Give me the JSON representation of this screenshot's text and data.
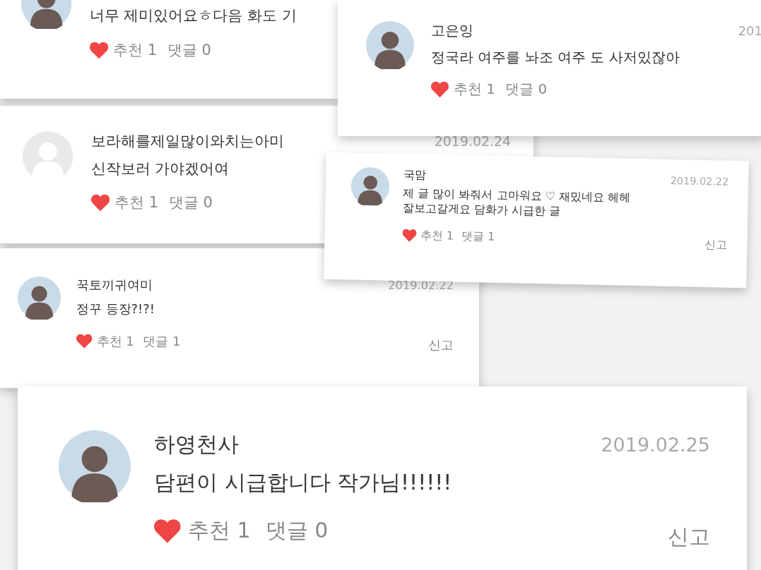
{
  "comments": [
    {
      "avatar": {
        "kind": "photo"
      },
      "lines": [
        "너무 제미있어요ㅎ다음 화도 기"
      ],
      "liked": true,
      "likes": "추천 1",
      "replies": "댓글 0"
    },
    {
      "avatar": {
        "kind": "default"
      },
      "name": "보라해를제일많이와치는아미",
      "date": "2019.02.24",
      "lines": [
        "신작보러 가야겠어여"
      ],
      "liked": true,
      "likes": "추천 1",
      "replies": "댓글 0"
    },
    {
      "avatar": {
        "kind": "photo"
      },
      "name": "고은잉",
      "date": "201",
      "lines": [
        "정국라 여주를 놔조 여주 도 사저있잖아"
      ],
      "liked": true,
      "likes": "추천 1",
      "replies": "댓글 0"
    },
    {
      "avatar": {
        "kind": "photo"
      },
      "name": "꾹토끼귀여미",
      "date": "2019.02.22",
      "lines": [
        "정꾸 등장?!?!"
      ],
      "liked": true,
      "likes": "추천 1",
      "replies": "댓글 1",
      "report": "신고"
    },
    {
      "avatar": {
        "kind": "photo"
      },
      "name": "국맘",
      "date": "2019.02.22",
      "lines": [
        "제 글 많이 봐줘서 고마워요 ♡ 재밌네요 헤헤",
        "잘보고갈게요 담화가 시급한 글"
      ],
      "liked": true,
      "likes": "추천 1",
      "replies": "댓글 1",
      "report": "신고"
    },
    {
      "avatar": {
        "kind": "photo"
      },
      "name": "하영천사",
      "date": "2019.02.25",
      "lines": [
        "담편이 시급합니다 작가님!!!!!!"
      ],
      "liked": true,
      "likes": "추천 1",
      "replies": "댓글 0",
      "report": "신고"
    }
  ]
}
